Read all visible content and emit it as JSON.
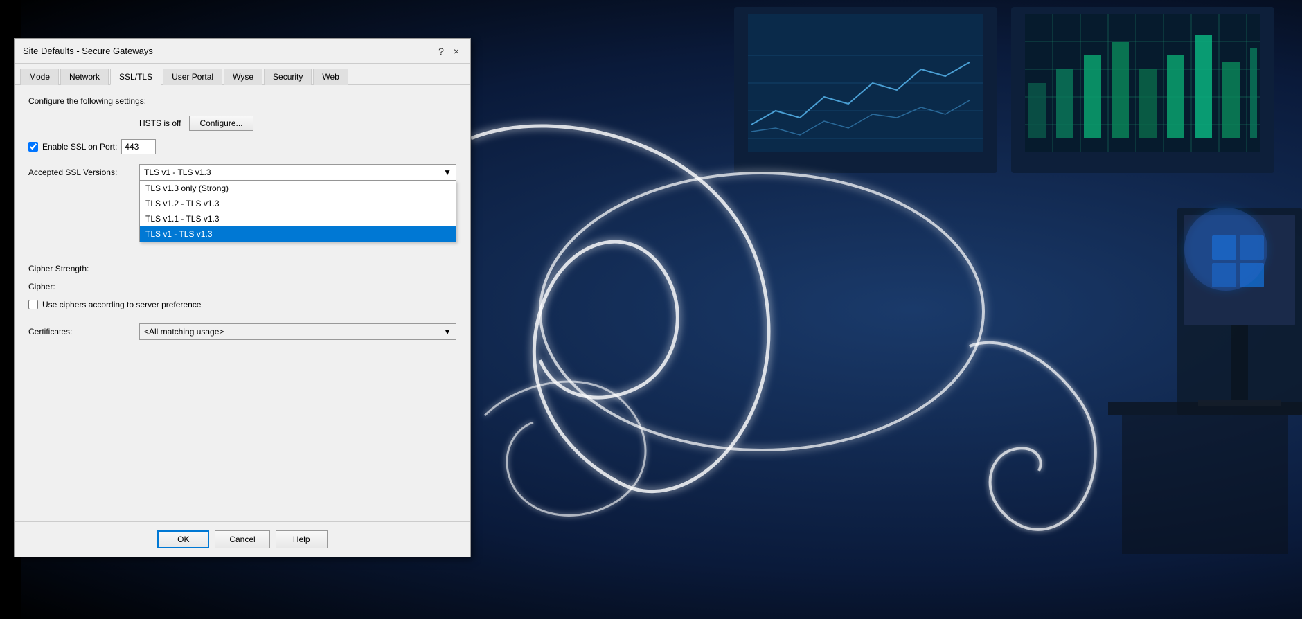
{
  "background": {
    "color": "#0a1a3a"
  },
  "dialog": {
    "title": "Site Defaults - Secure Gateways",
    "help_btn": "?",
    "close_btn": "×",
    "tabs": [
      {
        "id": "mode",
        "label": "Mode",
        "active": false
      },
      {
        "id": "network",
        "label": "Network",
        "active": false
      },
      {
        "id": "ssl_tls",
        "label": "SSL/TLS",
        "active": true
      },
      {
        "id": "user_portal",
        "label": "User Portal",
        "active": false
      },
      {
        "id": "wyse",
        "label": "Wyse",
        "active": false
      },
      {
        "id": "security",
        "label": "Security",
        "active": false
      },
      {
        "id": "web",
        "label": "Web",
        "active": false
      }
    ],
    "content": {
      "section_title": "Configure the following settings:",
      "hsts_label": "HSTS is off",
      "configure_btn": "Configure...",
      "enable_ssl_label": "Enable SSL on Port:",
      "enable_ssl_checked": true,
      "port_value": "443",
      "ssl_versions_label": "Accepted SSL Versions:",
      "ssl_versions_selected": "TLS v1 - TLS v1.3",
      "ssl_versions_options": [
        {
          "label": "TLS v1.3 only (Strong)",
          "selected": false
        },
        {
          "label": "TLS v1.2 - TLS v1.3",
          "selected": false
        },
        {
          "label": "TLS v1.1 - TLS v1.3",
          "selected": false
        },
        {
          "label": "TLS v1 - TLS v1.3",
          "selected": true
        }
      ],
      "cipher_strength_label": "Cipher Strength:",
      "cipher_strength_value": "",
      "cipher_label": "Cipher:",
      "cipher_value": "",
      "use_ciphers_label": "Use ciphers according to server preference",
      "use_ciphers_checked": false,
      "certificates_label": "Certificates:",
      "certificates_selected": "<All matching usage>"
    },
    "footer": {
      "ok_btn": "OK",
      "cancel_btn": "Cancel",
      "help_btn": "Help"
    }
  }
}
